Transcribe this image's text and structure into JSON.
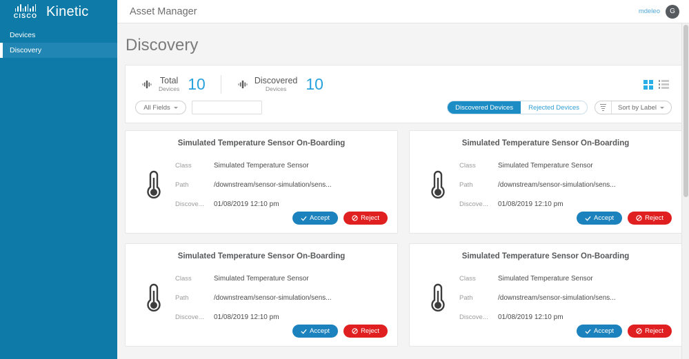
{
  "sidebar": {
    "brand": {
      "logo": "cisco-logo",
      "cisco_word": "CISCO",
      "name": "Kinetic"
    },
    "items": [
      {
        "label": "Devices",
        "active": false
      },
      {
        "label": "Discovery",
        "active": true
      }
    ]
  },
  "topbar": {
    "app_title": "Asset Manager",
    "username": "mdeleo",
    "avatar_initial": "G"
  },
  "page": {
    "title": "Discovery"
  },
  "stats": [
    {
      "icon": "sensor-icon",
      "label_line1": "Total",
      "label_line2": "Devices",
      "value": "10"
    },
    {
      "icon": "sensor-icon",
      "label_line1": "Discovered",
      "label_line2": "Devices",
      "value": "10"
    }
  ],
  "view_toggle": {
    "grid_label": "grid-view-icon",
    "list_label": "list-view-icon",
    "active": "grid"
  },
  "filters": {
    "field_select": "All Fields",
    "search_value": "",
    "search_placeholder": "",
    "segments": [
      {
        "label": "Discovered Devices",
        "active": true
      },
      {
        "label": "Rejected Devices",
        "active": false
      }
    ],
    "sort_icon": "sort-descending-icon",
    "sort_label": "Sort by Label"
  },
  "card_labels": {
    "class": "Class",
    "path": "Path",
    "discovered": "Discove...",
    "accept": "Accept",
    "reject": "Reject"
  },
  "cards": [
    {
      "title": "Simulated Temperature Sensor On-Boarding",
      "icon": "thermometer-icon",
      "class_value": "Simulated Temperature Sensor",
      "path_value": "/downstream/sensor-simulation/sens...",
      "discovered_value": "01/08/2019 12:10 pm"
    },
    {
      "title": "Simulated Temperature Sensor On-Boarding",
      "icon": "thermometer-icon",
      "class_value": "Simulated Temperature Sensor",
      "path_value": "/downstream/sensor-simulation/sens...",
      "discovered_value": "01/08/2019 12:10 pm"
    },
    {
      "title": "Simulated Temperature Sensor On-Boarding",
      "icon": "thermometer-icon",
      "class_value": "Simulated Temperature Sensor",
      "path_value": "/downstream/sensor-simulation/sens...",
      "discovered_value": "01/08/2019 12:10 pm"
    },
    {
      "title": "Simulated Temperature Sensor On-Boarding",
      "icon": "thermometer-icon",
      "class_value": "Simulated Temperature Sensor",
      "path_value": "/downstream/sensor-simulation/sens...",
      "discovered_value": "01/08/2019 12:10 pm"
    }
  ],
  "colors": {
    "sidebar_bg": "#0d7aa7",
    "sidebar_active": "#2186b3",
    "accent_blue": "#27a2dd",
    "accept_blue": "#1c82bd",
    "reject_red": "#e02020",
    "page_bg": "#f4f4f4"
  }
}
